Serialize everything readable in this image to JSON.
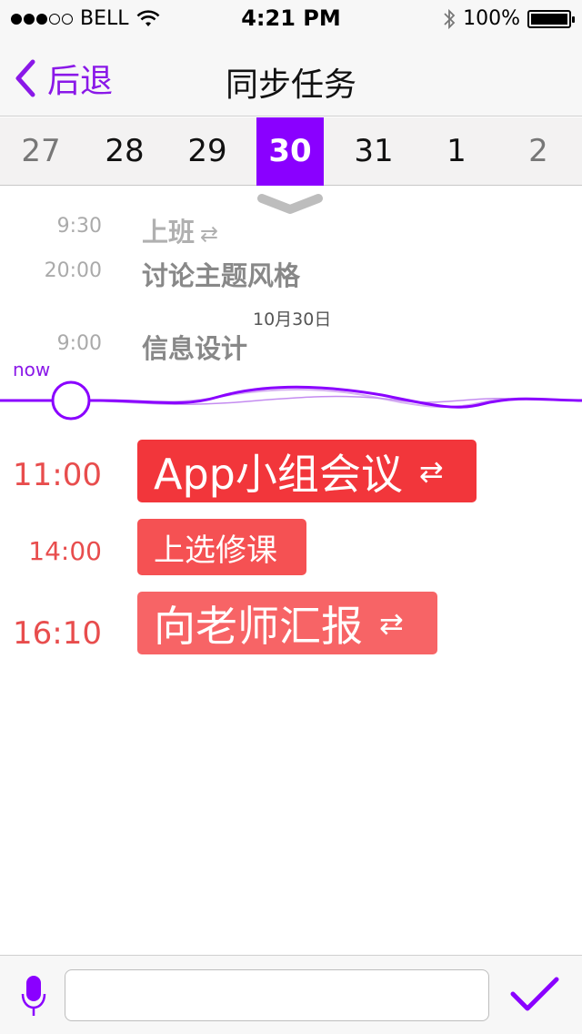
{
  "status_bar": {
    "carrier": "BELL",
    "time": "4:21 PM",
    "battery": "100%",
    "signal_dots_filled": 3,
    "signal_dots_total": 5
  },
  "nav": {
    "back_label": "后退",
    "title": "同步任务"
  },
  "date_strip": {
    "dates": [
      "27",
      "28",
      "29",
      "30",
      "31",
      "1",
      "2"
    ],
    "selected_index": 3
  },
  "past_events": [
    {
      "time": "9:30",
      "title": "上班",
      "sync_icon": "⇄"
    },
    {
      "time": "20:00",
      "title": "讨论主题风格"
    },
    {
      "time": "9:00",
      "title": "信息设计"
    }
  ],
  "day_separator": "10月30日",
  "now_label": "now",
  "upcoming_events": [
    {
      "time": "11:00",
      "title": "App小组会议",
      "sync_icon": "⇄",
      "color": "#f2363b"
    },
    {
      "time": "14:00",
      "title": "上选修课",
      "color": "#f55153"
    },
    {
      "time": "16:10",
      "title": "向老师汇报",
      "sync_icon": "⇄",
      "color": "#f76466"
    }
  ],
  "input": {
    "value": "",
    "placeholder": ""
  },
  "colors": {
    "accent": "#8a00ff",
    "event_red": "#f2363b",
    "time_red": "#e84d4d"
  },
  "icons": {
    "back": "chevron-left-icon",
    "mic": "microphone-icon",
    "confirm": "checkmark-icon",
    "sync": "sync-arrows-icon",
    "pull": "chevron-down-icon"
  }
}
